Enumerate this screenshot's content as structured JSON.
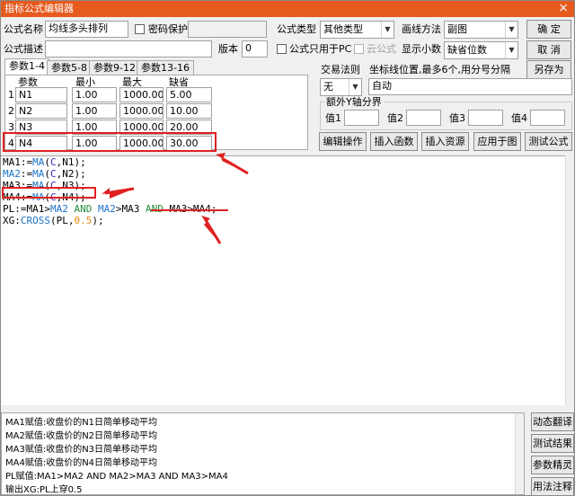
{
  "window": {
    "title": "指标公式编辑器",
    "close_glyph": "×"
  },
  "form": {
    "name_label": "公式名称",
    "name_value": "均线多头排列",
    "password_label": "密码保护",
    "desc_label": "公式描述",
    "desc_value": "",
    "version_label": "版本",
    "version_value": "0",
    "type_label": "公式类型",
    "type_value": "其他类型",
    "draw_label": "画线方法",
    "draw_value": "副图",
    "pc_only_label": "公式只用于PC",
    "cloud_label": "云公式",
    "decimals_label": "显示小数",
    "decimals_value": "缺省位数"
  },
  "buttons": {
    "ok": "确  定",
    "cancel": "取  消",
    "save_as": "另存为",
    "edit": "编辑操作",
    "insert_func": "插入函数",
    "insert_res": "插入资源",
    "apply": "应用于图",
    "test": "测试公式"
  },
  "right_buttons": [
    "动态翻译",
    "测试结果",
    "参数精灵",
    "用法注释"
  ],
  "tabs": [
    "参数1-4",
    "参数5-8",
    "参数9-12",
    "参数13-16"
  ],
  "params": {
    "headers": [
      "参数",
      "最小",
      "最大",
      "缺省"
    ],
    "rows": [
      {
        "idx": "1",
        "name": "N1",
        "min": "1.00",
        "max": "1000.00",
        "def": "5.00"
      },
      {
        "idx": "2",
        "name": "N2",
        "min": "1.00",
        "max": "1000.00",
        "def": "10.00"
      },
      {
        "idx": "3",
        "name": "N3",
        "min": "1.00",
        "max": "1000.00",
        "def": "20.00"
      },
      {
        "idx": "4",
        "name": "N4",
        "min": "1.00",
        "max": "1000.00",
        "def": "30.00"
      }
    ]
  },
  "trade": {
    "rule_label": "交易法则",
    "rule_value": "无",
    "coord_label": "坐标线位置,最多6个,用分号分隔",
    "coord_value": "自动",
    "extra_label": "额外Y轴分界",
    "values": [
      "值1",
      "值2",
      "值3",
      "值4"
    ]
  },
  "code": [
    [
      {
        "t": "MA1:=",
        "c": ""
      },
      {
        "t": "MA",
        "c": "kw-blue"
      },
      {
        "t": "(",
        "c": ""
      },
      {
        "t": "C",
        "c": "kw-purple"
      },
      {
        "t": ",N1);",
        "c": ""
      }
    ],
    [
      {
        "t": "MA2",
        "c": "kw-blue"
      },
      {
        "t": ":=",
        "c": ""
      },
      {
        "t": "MA",
        "c": "kw-blue"
      },
      {
        "t": "(",
        "c": ""
      },
      {
        "t": "C",
        "c": "kw-purple"
      },
      {
        "t": ",N2);",
        "c": ""
      }
    ],
    [
      {
        "t": "MA3:=",
        "c": ""
      },
      {
        "t": "MA",
        "c": "kw-blue"
      },
      {
        "t": "(",
        "c": ""
      },
      {
        "t": "C",
        "c": "kw-purple"
      },
      {
        "t": ",N3);",
        "c": ""
      }
    ],
    [
      {
        "t": "MA4:=",
        "c": ""
      },
      {
        "t": "MA",
        "c": "kw-blue"
      },
      {
        "t": "(",
        "c": ""
      },
      {
        "t": "C",
        "c": "kw-purple"
      },
      {
        "t": ",N4);",
        "c": ""
      }
    ],
    [
      {
        "t": "PL:=MA1>",
        "c": ""
      },
      {
        "t": "MA2",
        "c": "kw-blue"
      },
      {
        "t": " ",
        "c": ""
      },
      {
        "t": "AND",
        "c": "kw-green"
      },
      {
        "t": " ",
        "c": ""
      },
      {
        "t": "MA2",
        "c": "kw-blue"
      },
      {
        "t": ">MA3 ",
        "c": ""
      },
      {
        "t": "AND",
        "c": "kw-green"
      },
      {
        "t": " MA3>MA4;",
        "c": ""
      }
    ],
    [
      {
        "t": "XG:",
        "c": ""
      },
      {
        "t": "CROSS",
        "c": "kw-blue"
      },
      {
        "t": "(PL,",
        "c": ""
      },
      {
        "t": "0.5",
        "c": "kw-orange"
      },
      {
        "t": ");",
        "c": ""
      }
    ]
  ],
  "explanation": [
    "MA1赋值:收盘价的N1日简单移动平均",
    "MA2赋值:收盘价的N2日简单移动平均",
    "MA3赋值:收盘价的N3日简单移动平均",
    "MA4赋值:收盘价的N4日简单移动平均",
    "PL赋值:MA1>MA2 AND MA2>MA3 AND MA3>MA4",
    "输出XG:PL上穿0.5"
  ],
  "annotation_color": "#e02020"
}
